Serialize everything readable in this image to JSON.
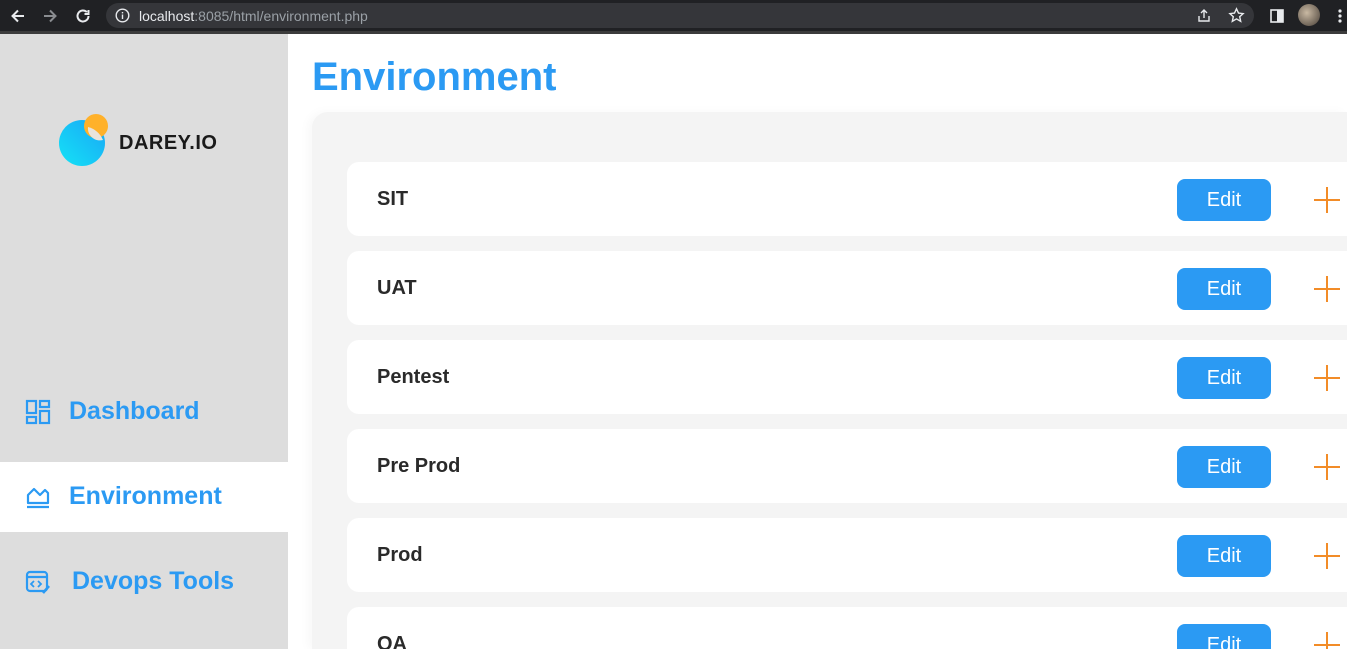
{
  "browser": {
    "url_host": "localhost",
    "url_rest": ":8085/html/environment.php"
  },
  "brand": {
    "name": "DAREY.IO",
    "accent": "#2b9af3",
    "plus_color": "#f28c28"
  },
  "sidebar": {
    "items": [
      {
        "label": "Dashboard",
        "icon": "dashboard-icon",
        "active": false
      },
      {
        "label": "Environment",
        "icon": "chart-icon",
        "active": true
      },
      {
        "label": "Devops Tools",
        "icon": "devops-tools-icon",
        "active": false
      }
    ]
  },
  "main": {
    "title": "Environment",
    "edit_label": "Edit",
    "environments": [
      {
        "name": "SIT"
      },
      {
        "name": "UAT"
      },
      {
        "name": "Pentest"
      },
      {
        "name": "Pre Prod"
      },
      {
        "name": "Prod"
      },
      {
        "name": "QA"
      }
    ]
  }
}
